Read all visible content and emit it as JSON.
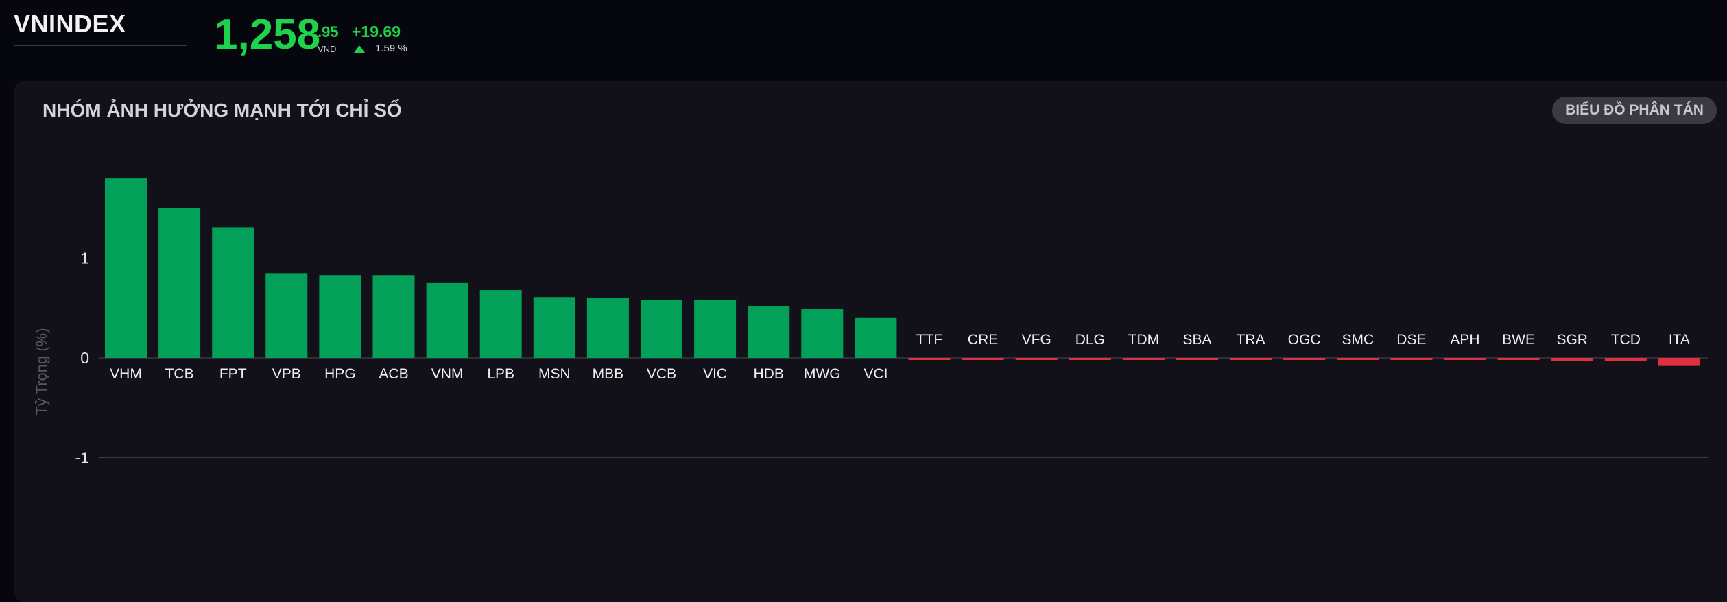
{
  "header": {
    "index_name": "VNINDEX",
    "price_main": "1,258",
    "price_decimal": ".95",
    "currency": "VND",
    "change": "+19.69",
    "change_percent": "1.59 %",
    "direction_icon": "triangle-up-icon",
    "up_color": "#1fd24c"
  },
  "panel": {
    "title": "NHÓM ẢNH HƯỞNG MẠNH TỚI CHỈ SỐ",
    "scatter_button": "BIỂU ĐỒ PHÂN TÁN"
  },
  "chart_data": {
    "type": "bar",
    "ylabel": "Tỷ Trọng (%)",
    "yticks": [
      1,
      0,
      -1
    ],
    "ylim": [
      -1.3,
      1.9
    ],
    "grid": true,
    "positive_color": "#03a05a",
    "negative_color": "#e0303d",
    "categories": [
      "VHM",
      "TCB",
      "FPT",
      "VPB",
      "HPG",
      "ACB",
      "VNM",
      "LPB",
      "MSN",
      "MBB",
      "VCB",
      "VIC",
      "HDB",
      "MWG",
      "VCI",
      "TTF",
      "CRE",
      "VFG",
      "DLG",
      "TDM",
      "SBA",
      "TRA",
      "OGC",
      "SMC",
      "DSE",
      "APH",
      "BWE",
      "SGR",
      "TCD",
      "ITA"
    ],
    "values": [
      1.8,
      1.5,
      1.31,
      0.85,
      0.83,
      0.83,
      0.75,
      0.68,
      0.61,
      0.6,
      0.58,
      0.58,
      0.52,
      0.49,
      0.4,
      -0.01,
      -0.01,
      -0.02,
      -0.02,
      -0.02,
      -0.02,
      -0.02,
      -0.02,
      -0.02,
      -0.02,
      -0.02,
      -0.02,
      -0.03,
      -0.03,
      -0.08
    ]
  }
}
